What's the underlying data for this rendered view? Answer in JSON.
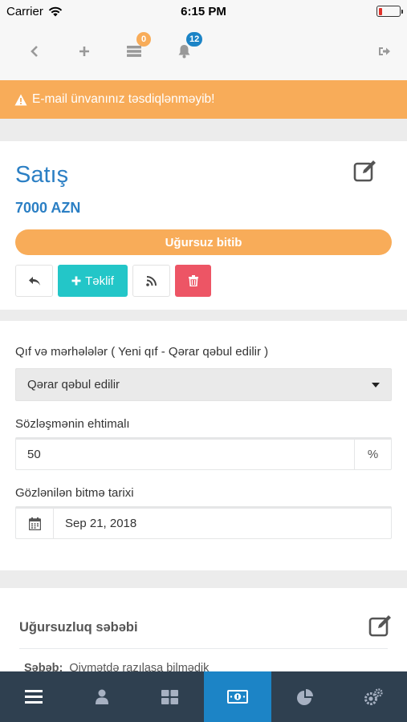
{
  "status_bar": {
    "carrier": "Carrier",
    "time": "6:15 PM"
  },
  "top_nav": {
    "badges": {
      "inbox": "0",
      "notifications": "12"
    },
    "icons": [
      "chevron-left-icon",
      "plus-icon",
      "tasks-icon",
      "bell-icon",
      "sign-out-icon"
    ],
    "colors": {
      "badge_orange": "#f8ac59",
      "badge_blue": "#1c84c6"
    }
  },
  "alert": {
    "text": "E-mail ünvanınız təsdiqlənməyib!",
    "color": "#f8ac59"
  },
  "deal": {
    "title": "Satış",
    "amount": "7000 AZN",
    "status": "Uğursuz bitib",
    "offer_label": "Təklif",
    "colors": {
      "title": "#2b7fc4",
      "offer": "#23c6c8",
      "delete": "#ed5565"
    }
  },
  "form": {
    "pipeline_label": "Qıf və mərhələlər ( Yeni qıf - Qərar qəbul edilir )",
    "pipeline_value": "Qərar qəbul edilir",
    "probability_label": "Sözləşmənin ehtimalı",
    "probability_value": "50",
    "probability_unit": "%",
    "close_date_label": "Gözlənilən bitmə tarixi",
    "close_date_value": "Sep 21, 2018"
  },
  "reason": {
    "title": "Uğursuzluq səbəbi",
    "key": "Səbəb:",
    "value": "Qiymətdə razılaşa bilmədik"
  },
  "tab_bar": {
    "tabs": [
      "menu-icon",
      "user-icon",
      "grid-icon",
      "money-icon",
      "pie-chart-icon",
      "settings-icon"
    ],
    "active_index": 3,
    "colors": {
      "background": "#2f4050",
      "active": "#1c84c6"
    }
  }
}
